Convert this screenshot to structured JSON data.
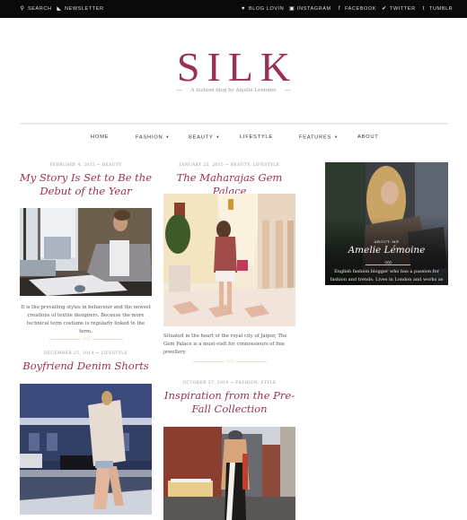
{
  "topbar": {
    "left": [
      {
        "icon": "search-icon",
        "glyph": "⚲",
        "label": "SEARCH"
      },
      {
        "icon": "rss-icon",
        "glyph": "◣",
        "label": "NEWSLETTER"
      }
    ],
    "right": [
      {
        "icon": "heart-icon",
        "glyph": "♥",
        "label": "BLOG LOVIN"
      },
      {
        "icon": "instagram-icon",
        "glyph": "▣",
        "label": "INSTAGRAM"
      },
      {
        "icon": "facebook-icon",
        "glyph": "f",
        "label": "FACEBOOK"
      },
      {
        "icon": "twitter-icon",
        "glyph": "✔",
        "label": "TWITTER"
      },
      {
        "icon": "tumblr-icon",
        "glyph": "t",
        "label": "TUMBLR"
      }
    ]
  },
  "brand": {
    "logo": "SILK",
    "tagline": "A fashion blog by Amelie Lémoine",
    "accent_color": "#9b2f55"
  },
  "nav": {
    "items": [
      {
        "label": "HOME",
        "has_dropdown": false
      },
      {
        "label": "FASHION",
        "has_dropdown": true
      },
      {
        "label": "BEAUTY",
        "has_dropdown": true
      },
      {
        "label": "LIFESTYLE",
        "has_dropdown": false
      },
      {
        "label": "FEATURES",
        "has_dropdown": true
      },
      {
        "label": "ABOUT",
        "has_dropdown": false
      }
    ],
    "caret": "▼"
  },
  "posts": [
    {
      "meta": "FEBRUARY 4, 2015 ~ BEAUTY",
      "title": "My Story Is Set to Be the Debut of the Year",
      "image": "woman-writing-at-desk-photo",
      "excerpt": "It is the prevailing styles in behaviour and the newest creations of textile designers. Because the more technical term costume is regularly linked to the term."
    },
    {
      "meta": "JANUARY 25, 2015 ~ BEAUTY, LIFESTYLE",
      "title": "The Maharajas Gem Palace",
      "image": "woman-in-palace-hallway-photo",
      "excerpt": "Situated in the heart of the royal city of Jaipur, The Gem Palace is a must-visit for connossieurs of fine jewellery."
    },
    {
      "meta": "DECEMBER 25, 2014 ~ LIFESTYLE",
      "title": "Boyfriend Denim Shorts",
      "image": "woman-walking-street-photo"
    },
    {
      "meta": "OCTOBER 27, 2014 ~ FASHION, STYLE",
      "title": "Inspiration from the Pre-Fall Collection",
      "image": "woman-city-street-photo"
    }
  ],
  "ornament": "◇◇◇",
  "sidebar": {
    "about_label": "ABOUT ME",
    "name": "Amelie Lémoine",
    "text": "English fashion blogger who has a passion for fashion and trends. Lives in London and works as"
  }
}
